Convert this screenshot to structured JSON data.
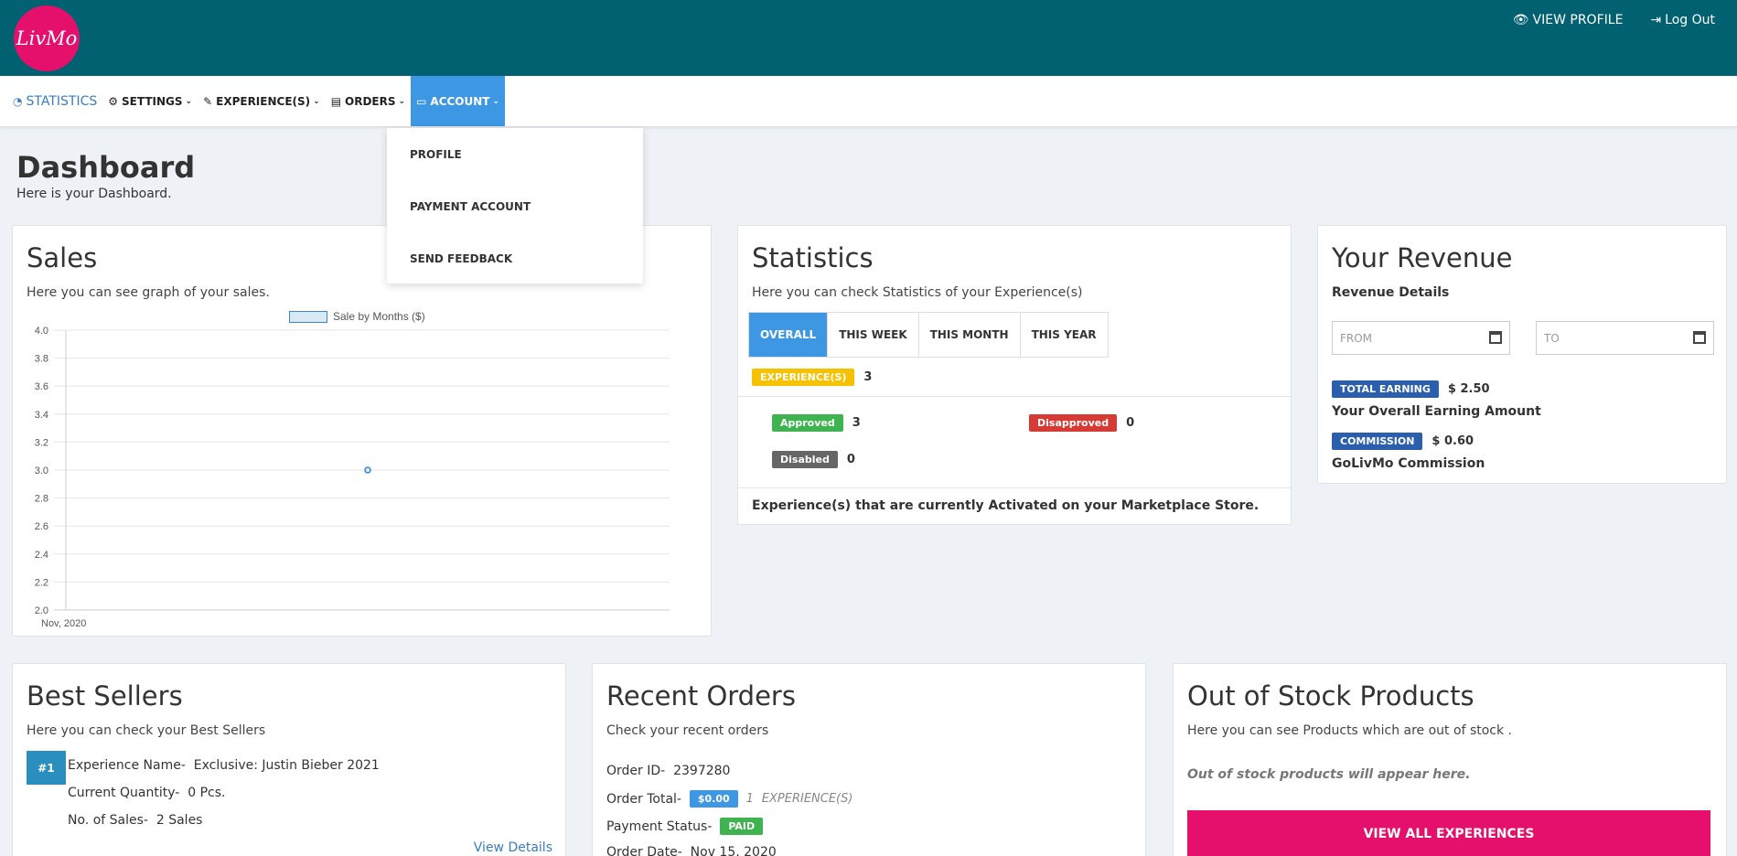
{
  "brand": {
    "logo_text": "LivMo"
  },
  "topbar": {
    "view_profile": "VIEW PROFILE",
    "logout": "Log Out"
  },
  "nav": {
    "statistics": "STATISTICS",
    "settings": "SETTINGS",
    "experiences": "EXPERIENCE(S)",
    "orders": "ORDERS",
    "account": "ACCOUNT"
  },
  "account_menu": {
    "profile": "PROFILE",
    "payment": "PAYMENT ACCOUNT",
    "feedback": "SEND FEEDBACK"
  },
  "page": {
    "title": "Dashboard",
    "subtitle": "Here is your Dashboard."
  },
  "sales": {
    "title": "Sales",
    "subtitle": "Here you can see graph of your sales."
  },
  "chart_data": {
    "type": "line",
    "categories": [
      "Nov, 2020"
    ],
    "series": [
      {
        "name": "Sale by Months ($)",
        "values": [
          3.0
        ]
      }
    ],
    "ylim": [
      2.0,
      4.0
    ],
    "yticks": [
      "2.0",
      "2.2",
      "2.4",
      "2.6",
      "2.8",
      "3.0",
      "3.2",
      "3.4",
      "3.6",
      "3.8",
      "4.0"
    ],
    "grid": true,
    "legend": "top"
  },
  "statistics": {
    "title": "Statistics",
    "subtitle": "Here you can check Statistics of your Experience(s)",
    "tabs": [
      "OVERALL",
      "THIS WEEK",
      "THIS MONTH",
      "THIS YEAR"
    ],
    "experiences_label": "EXPERIENCE(S)",
    "experiences_count": "3",
    "approved_label": "Approved",
    "approved_count": "3",
    "disapproved_label": "Disapproved",
    "disapproved_count": "0",
    "disabled_label": "Disabled",
    "disabled_count": "0",
    "footer": "Experience(s) that are currently Activated on your Marketplace Store.",
    "colors": {
      "experiences": "#f6c100",
      "approved": "#3fb34f",
      "disapproved": "#d63a35",
      "disabled": "#666666"
    }
  },
  "revenue": {
    "title": "Your Revenue",
    "subtitle": "Revenue Details",
    "from_placeholder": "FROM",
    "to_placeholder": "TO",
    "total_label": "TOTAL EARNING",
    "total_value": "$ 2.50",
    "total_desc": "Your Overall Earning Amount",
    "commission_label": "COMMISSION",
    "commission_value": "$ 0.60",
    "commission_desc": "GoLivMo Commission"
  },
  "best_sellers": {
    "title": "Best Sellers",
    "subtitle": "Here you can check your Best Sellers",
    "items": [
      {
        "rank": "#1",
        "name_label": "Experience Name-",
        "name": "Exclusive: Justin Bieber 2021",
        "qty_label": "Current Quantity-",
        "qty": "0 Pcs.",
        "sales_label": "No. of Sales-",
        "sales": "2 Sales"
      }
    ],
    "view_details": "View Details"
  },
  "recent_orders": {
    "title": "Recent Orders",
    "subtitle": "Check your recent orders",
    "order_id_label": "Order ID-",
    "order_id": "2397280",
    "total_label": "Order Total-",
    "total": "$0.00",
    "items_count": "1",
    "items_unit": "EXPERIENCE(S)",
    "payment_label": "Payment Status-",
    "payment_status": "PAID",
    "date_label": "Order Date-",
    "date": "Nov 15, 2020"
  },
  "out_of_stock": {
    "title": "Out of Stock Products",
    "subtitle": "Here you can see Products which are out of stock .",
    "empty": "Out of stock products will appear here.",
    "button": "VIEW ALL EXPERIENCES"
  }
}
